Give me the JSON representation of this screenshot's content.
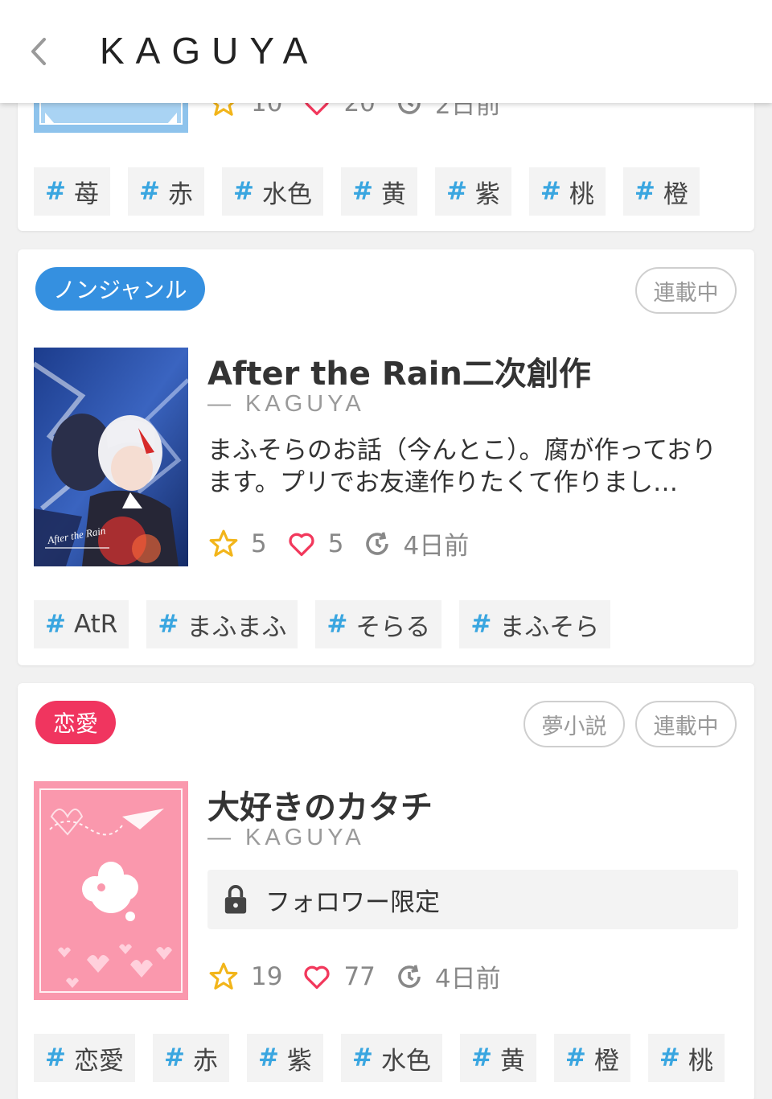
{
  "header": {
    "title": "KAGUYA"
  },
  "cards": [
    {
      "stats": {
        "stars": "10",
        "hearts": "20",
        "time": "2日前"
      },
      "tags": [
        "苺",
        "赤",
        "水色",
        "黄",
        "紫",
        "桃",
        "橙"
      ]
    },
    {
      "genre": "ノンジャンル",
      "badges": [
        "連載中"
      ],
      "title": "After the Rain二次創作",
      "author": "— KAGUYA",
      "description": "まふそらのお話（今んとこ）。腐が作っております。プリでお友達作りたくて作りまし…",
      "cover_text": "After the Rain",
      "stats": {
        "stars": "5",
        "hearts": "5",
        "time": "4日前"
      },
      "tags": [
        "AtR",
        "まふまふ",
        "そらる",
        "まふそら"
      ]
    },
    {
      "genre": "恋愛",
      "badges": [
        "夢小説",
        "連載中"
      ],
      "title": "大好きのカタチ",
      "author": "— KAGUYA",
      "locked_text": "フォロワー限定",
      "stats": {
        "stars": "19",
        "hearts": "77",
        "time": "4日前"
      },
      "tags": [
        "恋愛",
        "赤",
        "紫",
        "水色",
        "黄",
        "橙",
        "桃"
      ]
    }
  ],
  "colors": {
    "genre_nongenre": "#3590e0",
    "genre_romance": "#f0355f",
    "tag_hash": "#3aa6e0",
    "star": "#f2b51a",
    "heart": "#f2385c"
  },
  "icons": [
    "chevron-left-icon",
    "star-icon",
    "heart-icon",
    "history-icon",
    "lock-icon"
  ]
}
